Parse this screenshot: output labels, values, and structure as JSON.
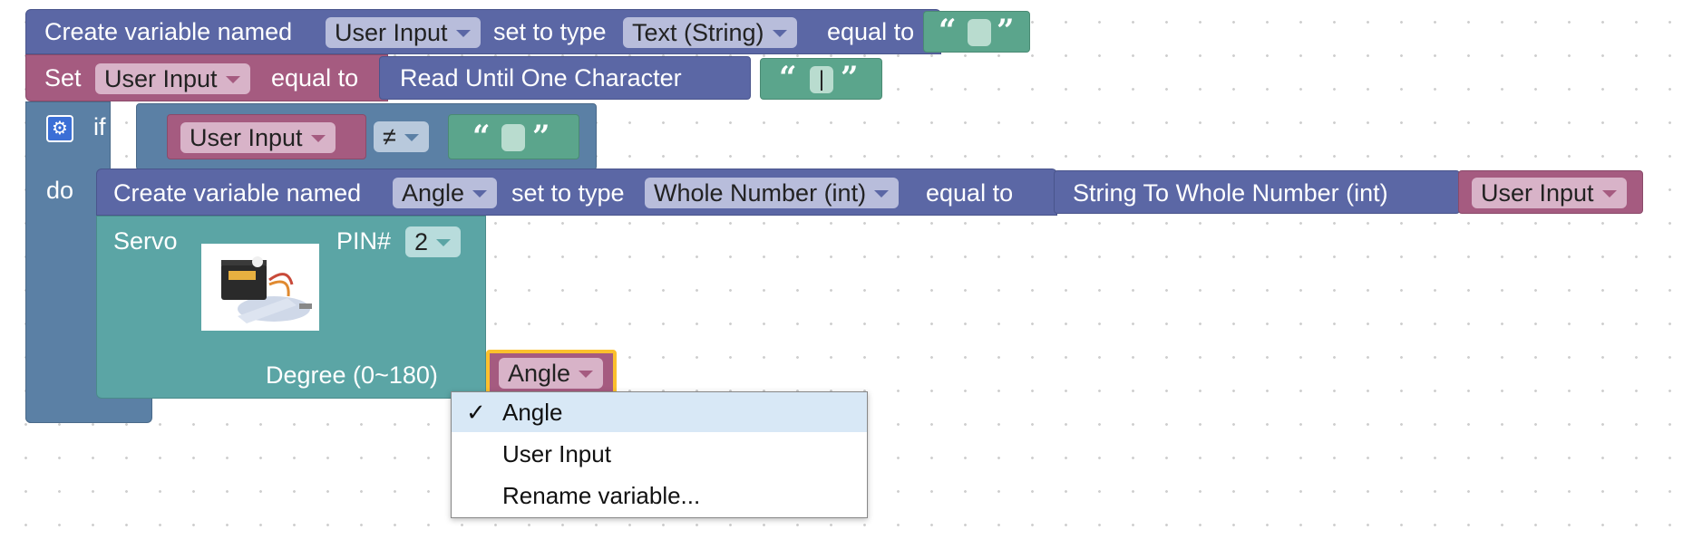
{
  "row1": {
    "create_label": "Create variable named",
    "var_name": "User Input",
    "set_type_label": "set to type",
    "type_value": "Text (String)",
    "equal_label": "equal to",
    "open_quote": "“",
    "close_quote": "”",
    "text_value": ""
  },
  "row2": {
    "set_label": "Set",
    "var_name": "User Input",
    "equal_label": "equal to",
    "read_label": "Read Until One Character",
    "open_quote": "“",
    "close_quote": "”",
    "text_value": "|"
  },
  "if_block": {
    "if_label": "if",
    "do_label": "do",
    "var_name": "User Input",
    "operator": "≠",
    "open_quote": "“",
    "close_quote": "”",
    "text_value": ""
  },
  "row4": {
    "create_label": "Create variable named",
    "var_name": "Angle",
    "set_type_label": "set to type",
    "type_value": "Whole Number (int)",
    "equal_label": "equal to",
    "convert_label": "String To Whole Number (int)",
    "arg_var": "User Input"
  },
  "servo": {
    "title": "Servo",
    "pin_label": "PIN#",
    "pin_value": "2",
    "degree_label": "Degree (0~180)",
    "angle_var": "Angle"
  },
  "menu": {
    "check_glyph": "✓",
    "items": [
      "Angle",
      "User Input",
      "Rename variable..."
    ]
  },
  "icons": [
    "gear-icon",
    "servo-image"
  ],
  "colors": {
    "variable_block": "#5b67a5",
    "set_block": "#a55b80",
    "text_block": "#5ba58c",
    "control_block": "#5b80a5",
    "servo_block": "#5ba5a5",
    "selected_highlight": "#fbc02d",
    "menu_selected": "#d8e8f6"
  }
}
